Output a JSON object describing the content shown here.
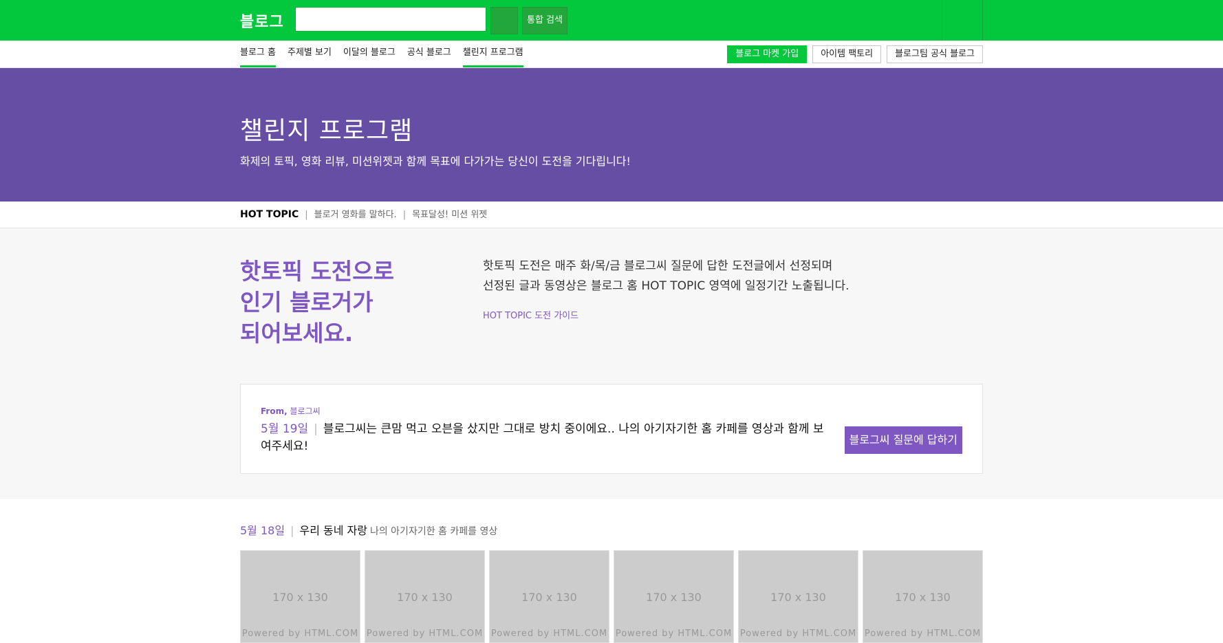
{
  "header": {
    "logo": "블로그",
    "search_placeholder": "",
    "total_search_label": "통합 검색"
  },
  "nav": {
    "items": [
      {
        "label": "블로그 홈"
      },
      {
        "label": "주제별 보기"
      },
      {
        "label": "이달의 블로그"
      },
      {
        "label": "공식 블로그"
      },
      {
        "label": "챌린지 프로그램"
      }
    ],
    "buttons": [
      {
        "label": "블로그 마켓 가입"
      },
      {
        "label": "아이템 팩토리"
      },
      {
        "label": "블로그팀 공식 블로그"
      }
    ]
  },
  "hero": {
    "title": "챌린지 프로그램",
    "description": "화제의 토픽, 영화 리뷰, 미션위젯과 함께 목표에 다가가는 당신이 도전을 기다립니다!"
  },
  "topic_bar": {
    "label": "HOT TOPIC",
    "links": [
      "블로거 영화를 말하다.",
      "목표달성! 미션 위젯"
    ]
  },
  "challenge": {
    "headline": [
      "핫토픽 도전으로",
      "인기 블로거가",
      "되어보세요."
    ],
    "desc_line1": "핫토픽 도전은 매주 화/목/금 블로그씨 질문에 답한 도전글에서 선정되며",
    "desc_line2": "선정된 글과 동영상은 블로그 홈 HOT TOPIC 영역에 일정기간 노출됩니다.",
    "guide_link": "HOT TOPIC 도전 가이드",
    "question": {
      "from_label": "From,",
      "from_name": "블로그씨",
      "date": "5월 19일",
      "text": "블로그씨는 큰맘 먹고 오븐을 샀지만 그대로 방치 중이에요.. 나의 아기자기한 홈 카페를 영상과 함께 보여주세요!",
      "answer_button": "블로그씨 질문에 답하기"
    }
  },
  "day_section": {
    "date": "5월 18일",
    "title": "우리 동네 자랑",
    "subtitle": "나의 아기자기한 홈 카페를 영상",
    "thumbnails": [
      {
        "size": "170 x 130",
        "credit": "Powered by HTML.COM"
      },
      {
        "size": "170 x 130",
        "credit": "Powered by HTML.COM"
      },
      {
        "size": "170 x 130",
        "credit": "Powered by HTML.COM"
      },
      {
        "size": "170 x 130",
        "credit": "Powered by HTML.COM"
      },
      {
        "size": "170 x 130",
        "credit": "Powered by HTML.COM"
      },
      {
        "size": "170 x 130",
        "credit": "Powered by HTML.COM"
      }
    ]
  },
  "colors": {
    "brand_green": "#03c73c",
    "hero_purple": "#654ea3",
    "accent_purple": "#7e57c2"
  }
}
